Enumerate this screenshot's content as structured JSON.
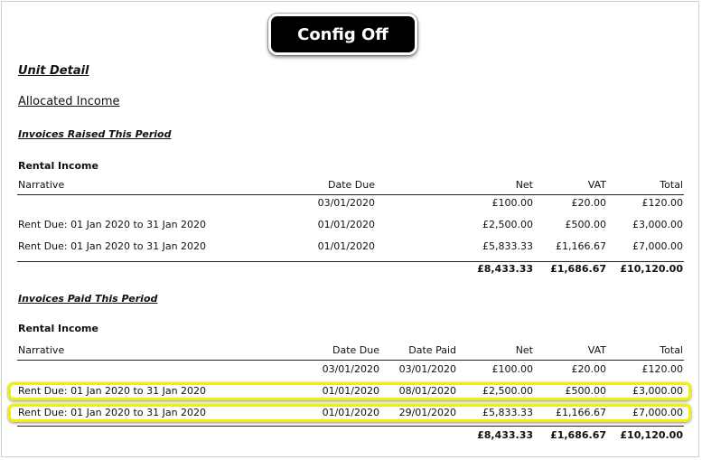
{
  "badge": "Config Off",
  "headings": {
    "unit_detail": "Unit Detail",
    "allocated_income": "Allocated Income",
    "raised": "Invoices Raised This Period",
    "paid": "Invoices Paid This Period"
  },
  "raised": {
    "group": "Rental Income",
    "cols": {
      "narrative": "Narrative",
      "date_due": "Date Due",
      "net": "Net",
      "vat": "VAT",
      "total": "Total"
    },
    "rows": [
      {
        "narrative": "",
        "date_due": "03/01/2020",
        "net": "£100.00",
        "vat": "£20.00",
        "total": "£120.00"
      },
      {
        "narrative": "Rent Due:  01 Jan 2020 to 31 Jan 2020",
        "date_due": "01/01/2020",
        "net": "£2,500.00",
        "vat": "£500.00",
        "total": "£3,000.00"
      },
      {
        "narrative": "Rent Due:  01 Jan 2020 to 31 Jan 2020",
        "date_due": "01/01/2020",
        "net": "£5,833.33",
        "vat": "£1,166.67",
        "total": "£7,000.00"
      }
    ],
    "totals": {
      "net": "£8,433.33",
      "vat": "£1,686.67",
      "total": "£10,120.00"
    }
  },
  "paid": {
    "group": "Rental Income",
    "cols": {
      "narrative": "Narrative",
      "date_due": "Date Due",
      "date_paid": "Date Paid",
      "net": "Net",
      "vat": "VAT",
      "total": "Total"
    },
    "rows": [
      {
        "narrative": "",
        "date_due": "03/01/2020",
        "date_paid": "03/01/2020",
        "net": "£100.00",
        "vat": "£20.00",
        "total": "£120.00"
      },
      {
        "narrative": "Rent Due:  01 Jan 2020 to 31 Jan 2020",
        "date_due": "01/01/2020",
        "date_paid": "08/01/2020",
        "net": "£2,500.00",
        "vat": "£500.00",
        "total": "£3,000.00"
      },
      {
        "narrative": "Rent Due:  01 Jan 2020 to 31 Jan 2020",
        "date_due": "01/01/2020",
        "date_paid": "29/01/2020",
        "net": "£5,833.33",
        "vat": "£1,166.67",
        "total": "£7,000.00"
      }
    ],
    "totals": {
      "net": "£8,433.33",
      "vat": "£1,686.67",
      "total": "£10,120.00"
    }
  },
  "highlight_color": "#f0f000"
}
